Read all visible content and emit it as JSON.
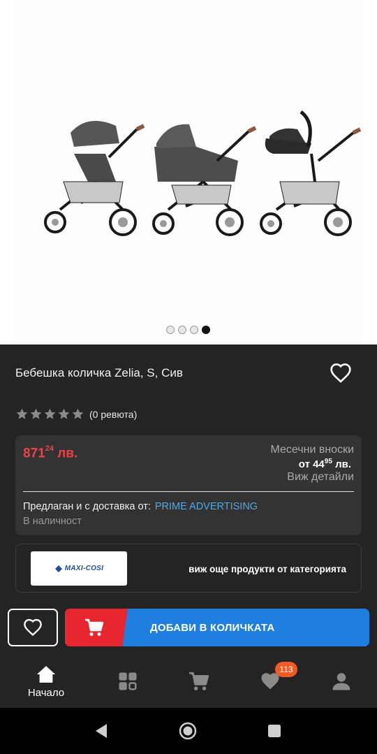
{
  "product": {
    "title": "Бебешка количка Zelia, S, Сив",
    "reviews": "(0 ревюта)",
    "rating_value": 0,
    "rating_max": 5,
    "carousel": {
      "count": 4,
      "active_index": 3
    }
  },
  "pricing": {
    "price_main": "871",
    "price_cents": "24",
    "price_currency": " лв.",
    "installments_label": "Месечни вноски",
    "installments_prefix": "от 44",
    "installments_cents": "95",
    "installments_currency": " лв.",
    "details_link": "Виж детайли",
    "seller_label": "Предлаган и с доставка от:",
    "seller_name": "PRIME ADVERTISING",
    "stock": "В наличност"
  },
  "brand": {
    "logo_text": "MAXI-COSI",
    "category_link": "виж още продукти от категорията"
  },
  "actions": {
    "add_to_cart": "ДОБАВИ В КОЛИЧКАТА"
  },
  "nav": {
    "home_label": "Начало",
    "wishlist_badge": "113",
    "items": [
      "home-icon",
      "grid-icon",
      "cart-icon",
      "heart-icon",
      "user-icon"
    ]
  },
  "colors": {
    "background": "#242424",
    "price_red": "#e8434a",
    "link_blue": "#4fa8e8",
    "cart_blue": "#1f7fe0",
    "cart_red": "#e8262f",
    "badge_orange": "#f05a24"
  }
}
